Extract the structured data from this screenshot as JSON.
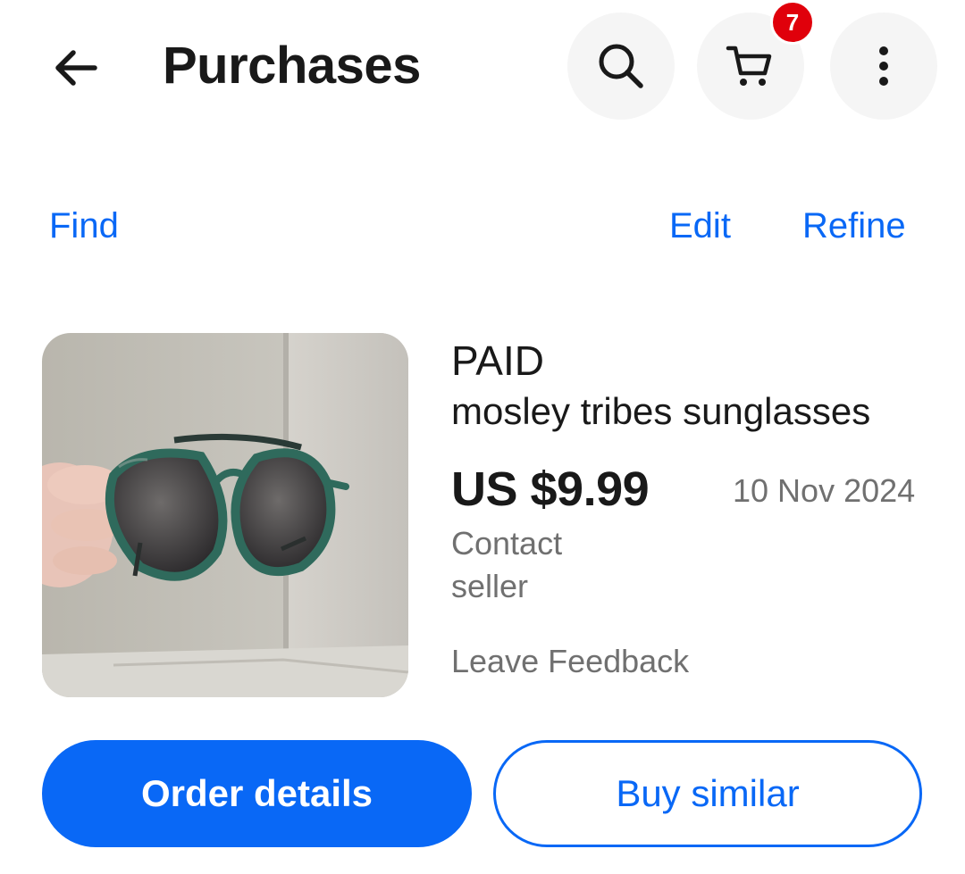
{
  "header": {
    "title": "Purchases",
    "back_icon": "arrow-left-icon",
    "search_icon": "search-icon",
    "cart_icon": "cart-icon",
    "cart_badge_count": "7",
    "more_icon": "more-vertical-icon"
  },
  "toolbar": {
    "find_label": "Find",
    "edit_label": "Edit",
    "refine_label": "Refine"
  },
  "order": {
    "status": "PAID",
    "title": "mosley tribes sunglasses",
    "price": "US $9.99",
    "date": "10 Nov 2024",
    "contact_label": "Contact seller",
    "feedback_label": "Leave Feedback",
    "primary_button": "Order details",
    "secondary_button": "Buy similar"
  },
  "colors": {
    "accent": "#0968f6",
    "badge": "#e0000b",
    "muted_text": "#707070"
  }
}
